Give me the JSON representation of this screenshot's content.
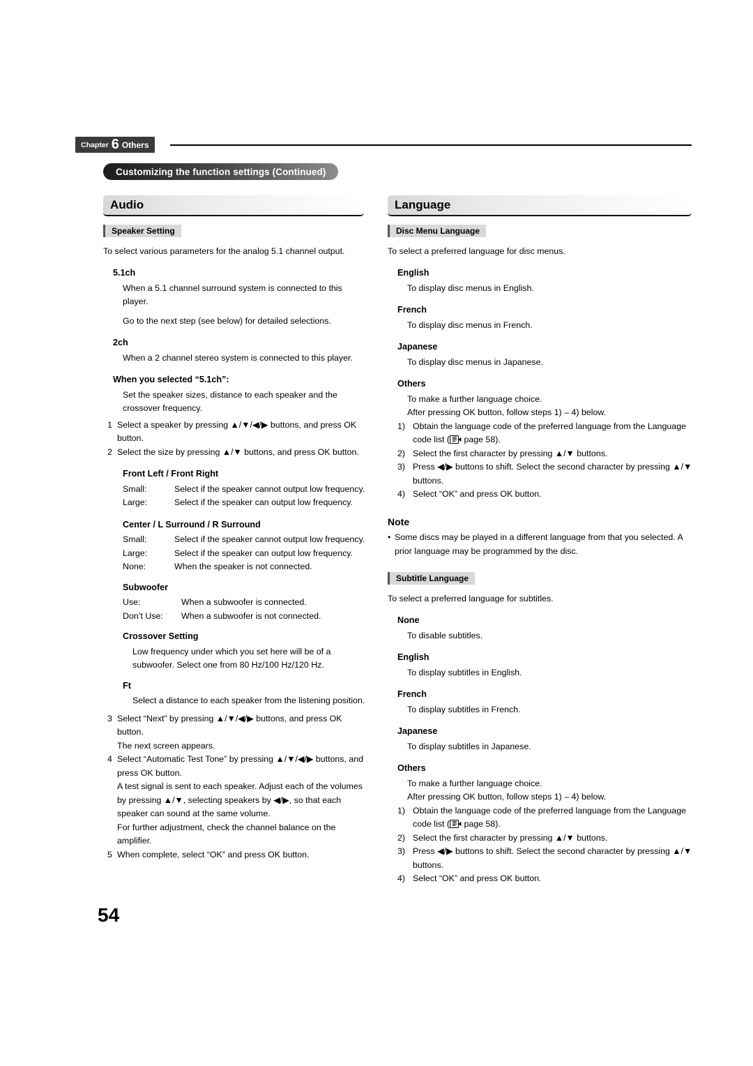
{
  "header": {
    "chapter_word": "Chapter",
    "chapter_number": "6",
    "chapter_name": "Others",
    "continued_banner": "Customizing the function settings (Continued)"
  },
  "page_number": "54",
  "left_column": {
    "section_title": "Audio",
    "speaker_setting": {
      "chip": "Speaker Setting",
      "intro": "To select various parameters for the analog 5.1 channel output.",
      "h_51ch": "5.1ch",
      "t_51ch_1": "When a 5.1 channel surround system is connected to this player.",
      "t_51ch_2": "Go to the next step (see below) for detailed selections.",
      "h_2ch": "2ch",
      "t_2ch": "When a 2 channel stereo system is connected to this player.",
      "h_when_selected": "When you selected “5.1ch”:",
      "t_when_selected": "Set the speaker sizes, distance to each speaker and the crossover frequency.",
      "step1_n": "1",
      "step1_t": "Select a speaker by pressing ▲/▼/◀/▶ buttons, and press OK button.",
      "step2_n": "2",
      "step2_t": "Select the size by pressing ▲/▼ buttons, and press OK button.",
      "h_front": "Front Left / Front Right",
      "front_rows": [
        {
          "label": "Small:",
          "desc": "Select if the speaker cannot output low frequency."
        },
        {
          "label": "Large:",
          "desc": "Select if the speaker can output low frequency."
        }
      ],
      "h_center": "Center / L Surround / R Surround",
      "center_rows": [
        {
          "label": "Small:",
          "desc": "Select if the speaker cannot output low frequency."
        },
        {
          "label": "Large:",
          "desc": "Select if the speaker can output low frequency."
        },
        {
          "label": "None:",
          "desc": "When the speaker is not connected."
        }
      ],
      "h_subwoofer": "Subwoofer",
      "subwoofer_rows": [
        {
          "label": "Use:",
          "desc": "When a subwoofer is connected."
        },
        {
          "label": "Don’t Use:",
          "desc": "When a subwoofer is not connected."
        }
      ],
      "h_crossover": "Crossover Setting",
      "t_crossover": "Low frequency under which you set here will be of a subwoofer. Select one from 80 Hz/100 Hz/120 Hz.",
      "h_ft": "Ft",
      "t_ft": "Select a distance to each speaker from the listening position.",
      "step3_n": "3",
      "step3_t": "Select “Next” by pressing ▲/▼/◀/▶ buttons, and press OK button.",
      "step3_t2": "The next screen appears.",
      "step4_n": "4",
      "step4_t": "Select “Automatic Test Tone” by pressing ▲/▼/◀/▶ buttons, and press OK button.",
      "step4_t2": "A test signal is sent to each speaker. Adjust each of the volumes by pressing ▲/▼, selecting speakers by ◀/▶, so that each speaker can sound at the same volume.",
      "step4_t3": "For further adjustment, check the channel balance on the amplifier.",
      "step5_n": "5",
      "step5_t": "When complete, select “OK” and press OK button."
    }
  },
  "right_column": {
    "section_title": "Language",
    "disc_menu": {
      "chip": "Disc Menu Language",
      "intro": "To select a preferred language for disc menus.",
      "items": [
        {
          "name": "English",
          "desc": "To display disc menus in English."
        },
        {
          "name": "French",
          "desc": "To display disc menus in French."
        },
        {
          "name": "Japanese",
          "desc": "To display disc menus in Japanese."
        },
        {
          "name": "Others",
          "desc": "To make a further language choice."
        }
      ],
      "after_text": "After pressing OK button, follow steps 1) – 4) below.",
      "steps": [
        {
          "n": "1)",
          "t_pre": "Obtain the language code of the preferred language from the Language code list (",
          "t_post": " page 58)."
        },
        {
          "n": "2)",
          "t": "Select the first character by pressing ▲/▼ buttons."
        },
        {
          "n": "3)",
          "t": "Press ◀/▶ buttons to shift. Select the second character by pressing ▲/▼ buttons."
        },
        {
          "n": "4)",
          "t": "Select “OK” and press OK button."
        }
      ]
    },
    "note": {
      "title": "Note",
      "bullet": "•",
      "text": "Some discs may be played in a different language from that you selected. A prior language may be programmed by the disc."
    },
    "subtitle_language": {
      "chip": "Subtitle Language",
      "intro": "To select a preferred language for subtitles.",
      "items": [
        {
          "name": "None",
          "desc": "To disable subtitles."
        },
        {
          "name": "English",
          "desc": "To display subtitles in English."
        },
        {
          "name": "French",
          "desc": "To display subtitles in French."
        },
        {
          "name": "Japanese",
          "desc": "To display subtitles in Japanese."
        },
        {
          "name": "Others",
          "desc": "To make a further language choice."
        }
      ],
      "after_text": "After pressing OK button, follow steps 1) – 4) below.",
      "steps": [
        {
          "n": "1)",
          "t_pre": "Obtain the language code of the preferred language from the Language code list (",
          "t_post": " page 58)."
        },
        {
          "n": "2)",
          "t": "Select the first character by pressing ▲/▼ buttons."
        },
        {
          "n": "3)",
          "t": "Press ◀/▶ buttons to shift. Select the second character by pressing ▲/▼ buttons."
        },
        {
          "n": "4)",
          "t": "Select “OK” and press OK button."
        }
      ]
    }
  }
}
